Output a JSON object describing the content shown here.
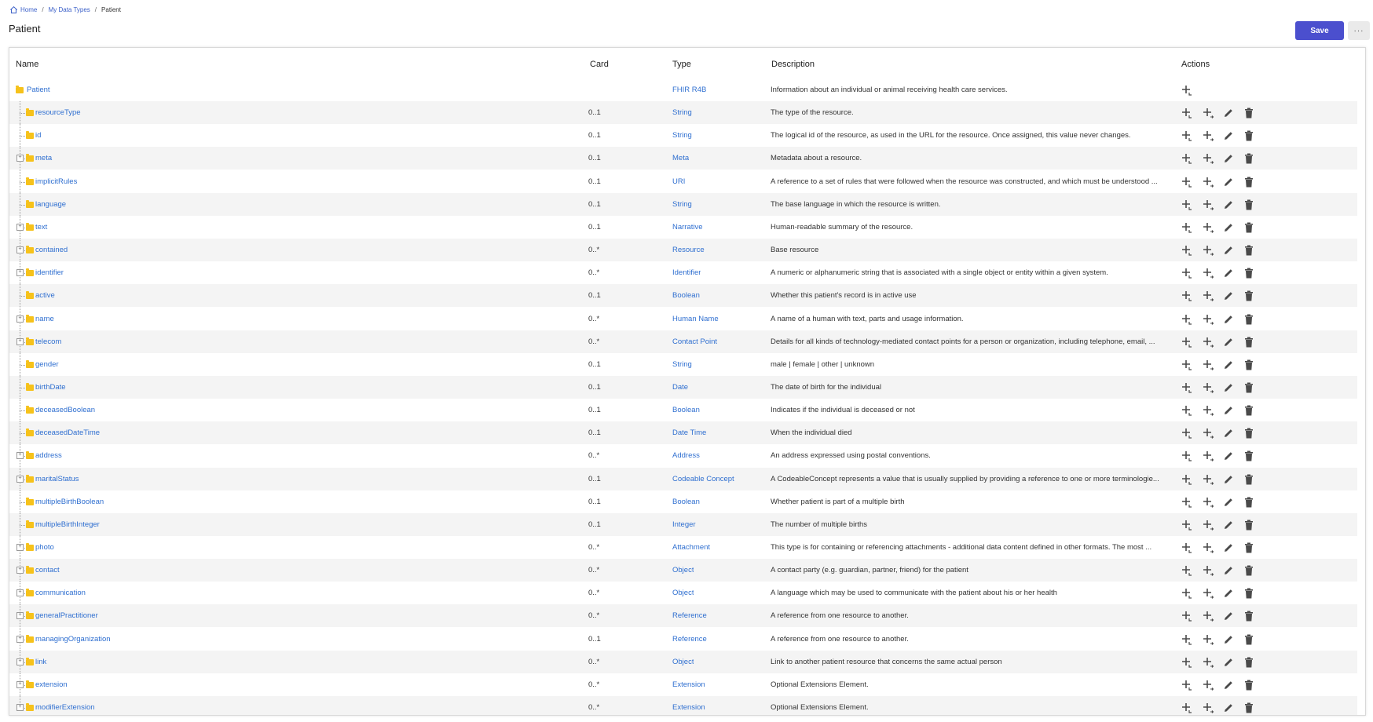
{
  "breadcrumb": {
    "home": "Home",
    "my_data_types": "My Data Types",
    "current": "Patient",
    "separator": "/"
  },
  "page": {
    "title": "Patient"
  },
  "toolbar": {
    "save_label": "Save",
    "more_label": "···"
  },
  "table": {
    "headers": {
      "name": "Name",
      "card": "Card",
      "type": "Type",
      "description": "Description",
      "actions": "Actions"
    },
    "rows": [
      {
        "name": "Patient",
        "card": "",
        "type": "FHIR R4B",
        "description": "Information about an individual or animal receiving health care services.",
        "level": 0,
        "expandable": false
      },
      {
        "name": "resourceType",
        "card": "0..1",
        "type": "String",
        "description": "The type of the resource.",
        "level": 1,
        "expandable": false
      },
      {
        "name": "id",
        "card": "0..1",
        "type": "String",
        "description": "The logical id of the resource, as used in the URL for the resource. Once assigned, this value never changes.",
        "level": 1,
        "expandable": false
      },
      {
        "name": "meta",
        "card": "0..1",
        "type": "Meta",
        "description": "Metadata about a resource.",
        "level": 1,
        "expandable": true
      },
      {
        "name": "implicitRules",
        "card": "0..1",
        "type": "URI",
        "description": "A reference to a set of rules that were followed when the resource was constructed, and which must be understood ...",
        "level": 1,
        "expandable": false
      },
      {
        "name": "language",
        "card": "0..1",
        "type": "String",
        "description": "The base language in which the resource is written.",
        "level": 1,
        "expandable": false
      },
      {
        "name": "text",
        "card": "0..1",
        "type": "Narrative",
        "description": "Human-readable summary of the resource.",
        "level": 1,
        "expandable": true
      },
      {
        "name": "contained",
        "card": "0..*",
        "type": "Resource",
        "description": "Base resource",
        "level": 1,
        "expandable": true
      },
      {
        "name": "identifier",
        "card": "0..*",
        "type": "Identifier",
        "description": "A numeric or alphanumeric string that is associated with a single object or entity within a given system.",
        "level": 1,
        "expandable": true
      },
      {
        "name": "active",
        "card": "0..1",
        "type": "Boolean",
        "description": "Whether this patient's record is in active use",
        "level": 1,
        "expandable": false
      },
      {
        "name": "name",
        "card": "0..*",
        "type": "Human Name",
        "description": "A name of a human with text, parts and usage information.",
        "level": 1,
        "expandable": true
      },
      {
        "name": "telecom",
        "card": "0..*",
        "type": "Contact Point",
        "description": "Details for all kinds of technology-mediated contact points for a person or organization, including telephone, email, ...",
        "level": 1,
        "expandable": true
      },
      {
        "name": "gender",
        "card": "0..1",
        "type": "String",
        "description": "male | female | other | unknown",
        "level": 1,
        "expandable": false
      },
      {
        "name": "birthDate",
        "card": "0..1",
        "type": "Date",
        "description": "The date of birth for the individual",
        "level": 1,
        "expandable": false
      },
      {
        "name": "deceasedBoolean",
        "card": "0..1",
        "type": "Boolean",
        "description": "Indicates if the individual is deceased or not",
        "level": 1,
        "expandable": false
      },
      {
        "name": "deceasedDateTime",
        "card": "0..1",
        "type": "Date Time",
        "description": "When the individual died",
        "level": 1,
        "expandable": false
      },
      {
        "name": "address",
        "card": "0..*",
        "type": "Address",
        "description": "An address expressed using postal conventions.",
        "level": 1,
        "expandable": true
      },
      {
        "name": "maritalStatus",
        "card": "0..1",
        "type": "Codeable Concept",
        "description": "A CodeableConcept represents a value that is usually supplied by providing a reference to one or more terminologie...",
        "level": 1,
        "expandable": true
      },
      {
        "name": "multipleBirthBoolean",
        "card": "0..1",
        "type": "Boolean",
        "description": "Whether patient is part of a multiple birth",
        "level": 1,
        "expandable": false
      },
      {
        "name": "multipleBirthInteger",
        "card": "0..1",
        "type": "Integer",
        "description": "The number of multiple births",
        "level": 1,
        "expandable": false
      },
      {
        "name": "photo",
        "card": "0..*",
        "type": "Attachment",
        "description": "This type is for containing or referencing attachments - additional data content defined in other formats. The most ...",
        "level": 1,
        "expandable": true
      },
      {
        "name": "contact",
        "card": "0..*",
        "type": "Object",
        "description": "A contact party (e.g. guardian, partner, friend) for the patient",
        "level": 1,
        "expandable": true
      },
      {
        "name": "communication",
        "card": "0..*",
        "type": "Object",
        "description": "A language which may be used to communicate with the patient about his or her health",
        "level": 1,
        "expandable": true
      },
      {
        "name": "generalPractitioner",
        "card": "0..*",
        "type": "Reference",
        "description": "A reference from one resource to another.",
        "level": 1,
        "expandable": true
      },
      {
        "name": "managingOrganization",
        "card": "0..1",
        "type": "Reference",
        "description": "A reference from one resource to another.",
        "level": 1,
        "expandable": true
      },
      {
        "name": "link",
        "card": "0..*",
        "type": "Object",
        "description": "Link to another patient resource that concerns the same actual person",
        "level": 1,
        "expandable": true
      },
      {
        "name": "extension",
        "card": "0..*",
        "type": "Extension",
        "description": "Optional Extensions Element.",
        "level": 1,
        "expandable": true
      },
      {
        "name": "modifierExtension",
        "card": "0..*",
        "type": "Extension",
        "description": "Optional Extensions Element.",
        "level": 1,
        "expandable": true
      }
    ]
  },
  "icons": {
    "home": "home-icon",
    "folder": "folder-icon",
    "add_child": "add-child-icon",
    "add_sibling": "add-sibling-icon",
    "edit": "pencil-icon",
    "delete": "trash-icon"
  },
  "colors": {
    "accent": "#4b4fce",
    "link": "#2f6fd0",
    "folder": "#f6c21b",
    "row_alt": "#f4f4f4",
    "icon": "#4a4a4a"
  }
}
